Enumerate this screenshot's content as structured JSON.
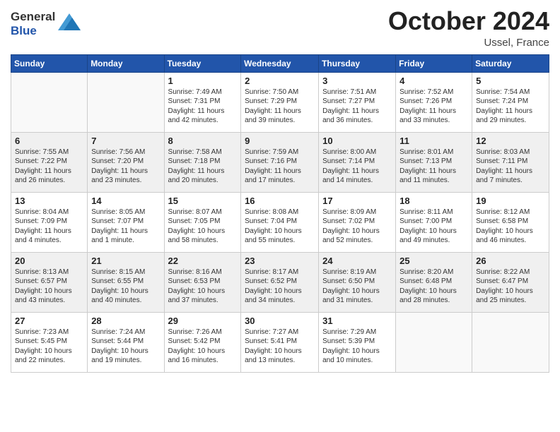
{
  "header": {
    "logo_general": "General",
    "logo_blue": "Blue",
    "month_title": "October 2024",
    "location": "Ussel, France"
  },
  "days_of_week": [
    "Sunday",
    "Monday",
    "Tuesday",
    "Wednesday",
    "Thursday",
    "Friday",
    "Saturday"
  ],
  "weeks": [
    {
      "shaded": false,
      "days": [
        {
          "date": "",
          "sunrise": "",
          "sunset": "",
          "daylight": ""
        },
        {
          "date": "",
          "sunrise": "",
          "sunset": "",
          "daylight": ""
        },
        {
          "date": "1",
          "sunrise": "Sunrise: 7:49 AM",
          "sunset": "Sunset: 7:31 PM",
          "daylight": "Daylight: 11 hours and 42 minutes."
        },
        {
          "date": "2",
          "sunrise": "Sunrise: 7:50 AM",
          "sunset": "Sunset: 7:29 PM",
          "daylight": "Daylight: 11 hours and 39 minutes."
        },
        {
          "date": "3",
          "sunrise": "Sunrise: 7:51 AM",
          "sunset": "Sunset: 7:27 PM",
          "daylight": "Daylight: 11 hours and 36 minutes."
        },
        {
          "date": "4",
          "sunrise": "Sunrise: 7:52 AM",
          "sunset": "Sunset: 7:26 PM",
          "daylight": "Daylight: 11 hours and 33 minutes."
        },
        {
          "date": "5",
          "sunrise": "Sunrise: 7:54 AM",
          "sunset": "Sunset: 7:24 PM",
          "daylight": "Daylight: 11 hours and 29 minutes."
        }
      ]
    },
    {
      "shaded": true,
      "days": [
        {
          "date": "6",
          "sunrise": "Sunrise: 7:55 AM",
          "sunset": "Sunset: 7:22 PM",
          "daylight": "Daylight: 11 hours and 26 minutes."
        },
        {
          "date": "7",
          "sunrise": "Sunrise: 7:56 AM",
          "sunset": "Sunset: 7:20 PM",
          "daylight": "Daylight: 11 hours and 23 minutes."
        },
        {
          "date": "8",
          "sunrise": "Sunrise: 7:58 AM",
          "sunset": "Sunset: 7:18 PM",
          "daylight": "Daylight: 11 hours and 20 minutes."
        },
        {
          "date": "9",
          "sunrise": "Sunrise: 7:59 AM",
          "sunset": "Sunset: 7:16 PM",
          "daylight": "Daylight: 11 hours and 17 minutes."
        },
        {
          "date": "10",
          "sunrise": "Sunrise: 8:00 AM",
          "sunset": "Sunset: 7:14 PM",
          "daylight": "Daylight: 11 hours and 14 minutes."
        },
        {
          "date": "11",
          "sunrise": "Sunrise: 8:01 AM",
          "sunset": "Sunset: 7:13 PM",
          "daylight": "Daylight: 11 hours and 11 minutes."
        },
        {
          "date": "12",
          "sunrise": "Sunrise: 8:03 AM",
          "sunset": "Sunset: 7:11 PM",
          "daylight": "Daylight: 11 hours and 7 minutes."
        }
      ]
    },
    {
      "shaded": false,
      "days": [
        {
          "date": "13",
          "sunrise": "Sunrise: 8:04 AM",
          "sunset": "Sunset: 7:09 PM",
          "daylight": "Daylight: 11 hours and 4 minutes."
        },
        {
          "date": "14",
          "sunrise": "Sunrise: 8:05 AM",
          "sunset": "Sunset: 7:07 PM",
          "daylight": "Daylight: 11 hours and 1 minute."
        },
        {
          "date": "15",
          "sunrise": "Sunrise: 8:07 AM",
          "sunset": "Sunset: 7:05 PM",
          "daylight": "Daylight: 10 hours and 58 minutes."
        },
        {
          "date": "16",
          "sunrise": "Sunrise: 8:08 AM",
          "sunset": "Sunset: 7:04 PM",
          "daylight": "Daylight: 10 hours and 55 minutes."
        },
        {
          "date": "17",
          "sunrise": "Sunrise: 8:09 AM",
          "sunset": "Sunset: 7:02 PM",
          "daylight": "Daylight: 10 hours and 52 minutes."
        },
        {
          "date": "18",
          "sunrise": "Sunrise: 8:11 AM",
          "sunset": "Sunset: 7:00 PM",
          "daylight": "Daylight: 10 hours and 49 minutes."
        },
        {
          "date": "19",
          "sunrise": "Sunrise: 8:12 AM",
          "sunset": "Sunset: 6:58 PM",
          "daylight": "Daylight: 10 hours and 46 minutes."
        }
      ]
    },
    {
      "shaded": true,
      "days": [
        {
          "date": "20",
          "sunrise": "Sunrise: 8:13 AM",
          "sunset": "Sunset: 6:57 PM",
          "daylight": "Daylight: 10 hours and 43 minutes."
        },
        {
          "date": "21",
          "sunrise": "Sunrise: 8:15 AM",
          "sunset": "Sunset: 6:55 PM",
          "daylight": "Daylight: 10 hours and 40 minutes."
        },
        {
          "date": "22",
          "sunrise": "Sunrise: 8:16 AM",
          "sunset": "Sunset: 6:53 PM",
          "daylight": "Daylight: 10 hours and 37 minutes."
        },
        {
          "date": "23",
          "sunrise": "Sunrise: 8:17 AM",
          "sunset": "Sunset: 6:52 PM",
          "daylight": "Daylight: 10 hours and 34 minutes."
        },
        {
          "date": "24",
          "sunrise": "Sunrise: 8:19 AM",
          "sunset": "Sunset: 6:50 PM",
          "daylight": "Daylight: 10 hours and 31 minutes."
        },
        {
          "date": "25",
          "sunrise": "Sunrise: 8:20 AM",
          "sunset": "Sunset: 6:48 PM",
          "daylight": "Daylight: 10 hours and 28 minutes."
        },
        {
          "date": "26",
          "sunrise": "Sunrise: 8:22 AM",
          "sunset": "Sunset: 6:47 PM",
          "daylight": "Daylight: 10 hours and 25 minutes."
        }
      ]
    },
    {
      "shaded": false,
      "days": [
        {
          "date": "27",
          "sunrise": "Sunrise: 7:23 AM",
          "sunset": "Sunset: 5:45 PM",
          "daylight": "Daylight: 10 hours and 22 minutes."
        },
        {
          "date": "28",
          "sunrise": "Sunrise: 7:24 AM",
          "sunset": "Sunset: 5:44 PM",
          "daylight": "Daylight: 10 hours and 19 minutes."
        },
        {
          "date": "29",
          "sunrise": "Sunrise: 7:26 AM",
          "sunset": "Sunset: 5:42 PM",
          "daylight": "Daylight: 10 hours and 16 minutes."
        },
        {
          "date": "30",
          "sunrise": "Sunrise: 7:27 AM",
          "sunset": "Sunset: 5:41 PM",
          "daylight": "Daylight: 10 hours and 13 minutes."
        },
        {
          "date": "31",
          "sunrise": "Sunrise: 7:29 AM",
          "sunset": "Sunset: 5:39 PM",
          "daylight": "Daylight: 10 hours and 10 minutes."
        },
        {
          "date": "",
          "sunrise": "",
          "sunset": "",
          "daylight": ""
        },
        {
          "date": "",
          "sunrise": "",
          "sunset": "",
          "daylight": ""
        }
      ]
    }
  ]
}
